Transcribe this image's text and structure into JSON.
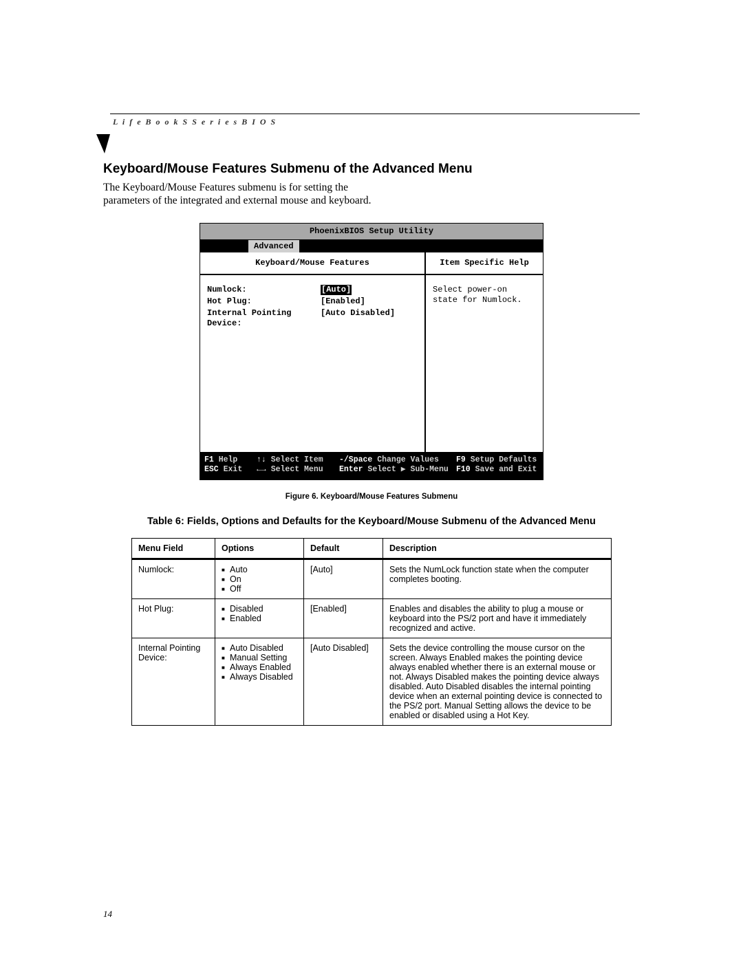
{
  "header": "L i f e B o o k   S   S e r i e s   B I O S",
  "section_title": "Keyboard/Mouse Features Submenu of the Advanced Menu",
  "intro": "The Keyboard/Mouse Features submenu is for setting the parameters of the integrated and external mouse and keyboard.",
  "bios": {
    "title": "PhoenixBIOS Setup Utility",
    "tab": "Advanced",
    "panel_title": "Keyboard/Mouse Features",
    "help_title": "Item Specific Help",
    "help_text": "Select power-on state for Numlock.",
    "rows": [
      {
        "label": "Numlock:",
        "value": "[Auto]",
        "selected": true
      },
      {
        "label": "Hot Plug:",
        "value": "[Enabled]",
        "selected": false
      },
      {
        "label": "Internal Pointing Device:",
        "value": "[Auto Disabled]",
        "selected": false
      }
    ],
    "footer": {
      "r1c1k": "F1",
      "r1c1v": "Help",
      "r1c2k": "↑↓",
      "r1c2v": "Select Item",
      "r1c3k": "-/Space",
      "r1c3v": "Change Values",
      "r1c4k": "F9",
      "r1c4v": "Setup Defaults",
      "r2c1k": "ESC",
      "r2c1v": "Exit",
      "r2c2k": "←→",
      "r2c2v": "Select Menu",
      "r2c3k": "Enter",
      "r2c3v": "Select ▶ Sub-Menu",
      "r2c4k": "F10",
      "r2c4v": "Save and Exit"
    }
  },
  "figure_caption": "Figure 6. Keyboard/Mouse Features Submenu",
  "table_title": "Table 6: Fields, Options and Defaults for the Keyboard/Mouse Submenu of the Advanced Menu",
  "table": {
    "headers": {
      "field": "Menu Field",
      "options": "Options",
      "def": "Default",
      "desc": "Description"
    },
    "rows": [
      {
        "field": "Numlock:",
        "options": [
          "Auto",
          "On",
          "Off"
        ],
        "def": "[Auto]",
        "desc": "Sets the NumLock function state when the computer completes booting."
      },
      {
        "field": "Hot Plug:",
        "options": [
          "Disabled",
          "Enabled"
        ],
        "def": "[Enabled]",
        "desc": "Enables and disables the ability to plug a mouse or keyboard into the PS/2 port and have it immediately recognized and active."
      },
      {
        "field": "Internal Pointing Device:",
        "options": [
          "Auto Disabled",
          "Manual Setting",
          "Always Enabled",
          "Always Disabled"
        ],
        "def": "[Auto Disabled]",
        "desc": "Sets the device controlling the mouse cursor on the screen. Always Enabled makes the pointing device always enabled whether there is an external mouse or not. Always Disabled makes the pointing device always disabled. Auto Disabled disables the internal pointing device when an external pointing device is connected to the PS/2 port. Manual Setting allows the device to be enabled or disabled using a Hot Key."
      }
    ]
  },
  "page_number": "14"
}
